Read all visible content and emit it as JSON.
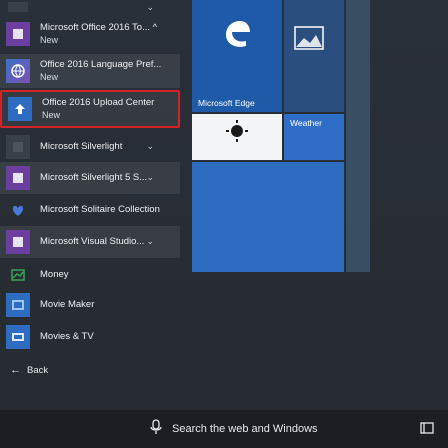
{
  "apps": [
    {
      "id": "top",
      "label": "",
      "sub": ""
    },
    {
      "id": "edge-recent",
      "label": "Microsoft Office 2016 To... ^",
      "sub": "New"
    },
    {
      "id": "office-lang",
      "label": "Office 2016 Language Pref...",
      "sub": "New"
    },
    {
      "id": "office-upload",
      "label": "Office 2016 Upload Center",
      "sub": "New"
    },
    {
      "id": "silverlight",
      "label": "Microsoft Silverlight",
      "sub": ""
    },
    {
      "id": "silverlight5",
      "label": "Microsoft Silverlight 5 S...",
      "sub": ""
    },
    {
      "id": "solitaire",
      "label": "Microsoft Solitaire Collection",
      "sub": ""
    },
    {
      "id": "visual-studio",
      "label": "Microsoft Visual Studio...",
      "sub": ""
    },
    {
      "id": "money",
      "label": "Money",
      "sub": ""
    },
    {
      "id": "movie-maker",
      "label": "Movie Maker",
      "sub": ""
    },
    {
      "id": "movies-tv",
      "label": "Movies & TV",
      "sub": ""
    }
  ],
  "back_label": "Back",
  "tiles": {
    "edge_label": "Microsoft Edge",
    "weather_label": "Weather"
  },
  "taskbar": {
    "search_label": "Search the web and Windows"
  },
  "colors": {
    "accent_red": "#d4222a",
    "edge_blue": "#1e5aa8",
    "weather_blue": "#2f6ec6"
  }
}
